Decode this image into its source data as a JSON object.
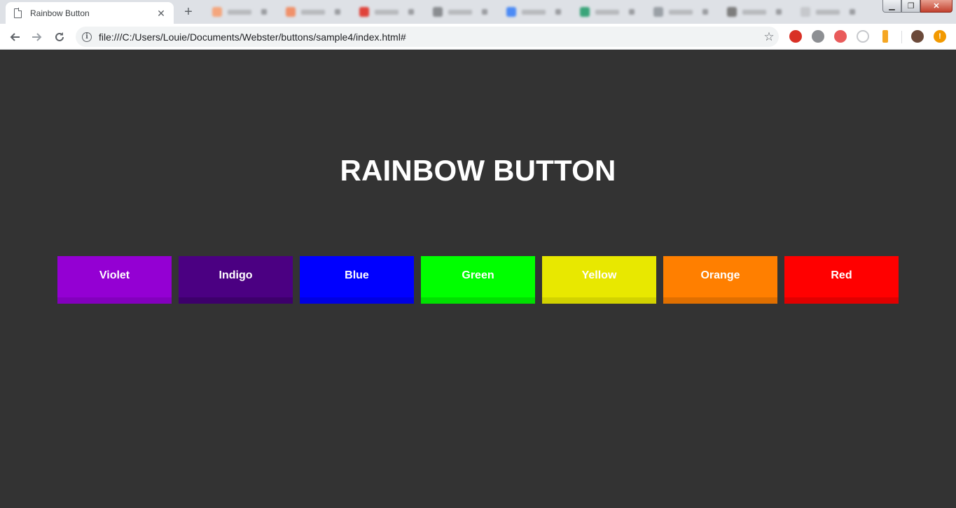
{
  "browser": {
    "tab_title": "Rainbow Button",
    "tab_close": "✕",
    "new_tab": "+",
    "url": "file:///C:/Users/Louie/Documents/Webster/buttons/sample4/index.html#",
    "background_tab_favicon_colors": [
      "#f4a67d",
      "#f0916a",
      "#e0433b",
      "#8a8d91",
      "#4c8bf5",
      "#3aa57a",
      "#9aa0a6",
      "#7d7d7d",
      "#c6c8cc"
    ],
    "extension_colors": [
      "#d93025",
      "#8d8f93",
      "#e95b5b",
      "#c6c8cc",
      "#f5a623",
      "#6b4a3a",
      "#f29900"
    ]
  },
  "page": {
    "title": "RAINBOW BUTTON",
    "buttons": [
      {
        "label": "Violet",
        "color": "#9400d3",
        "shade": "#8300bd"
      },
      {
        "label": "Indigo",
        "color": "#4b0082",
        "shade": "#3d006b"
      },
      {
        "label": "Blue",
        "color": "#0000ff",
        "shade": "#0000e0"
      },
      {
        "label": "Green",
        "color": "#00ff00",
        "shade": "#00e000"
      },
      {
        "label": "Yellow",
        "color": "#e8e800",
        "shade": "#d2d200"
      },
      {
        "label": "Orange",
        "color": "#ff7f00",
        "shade": "#e06f00"
      },
      {
        "label": "Red",
        "color": "#ff0000",
        "shade": "#e00000"
      }
    ]
  }
}
